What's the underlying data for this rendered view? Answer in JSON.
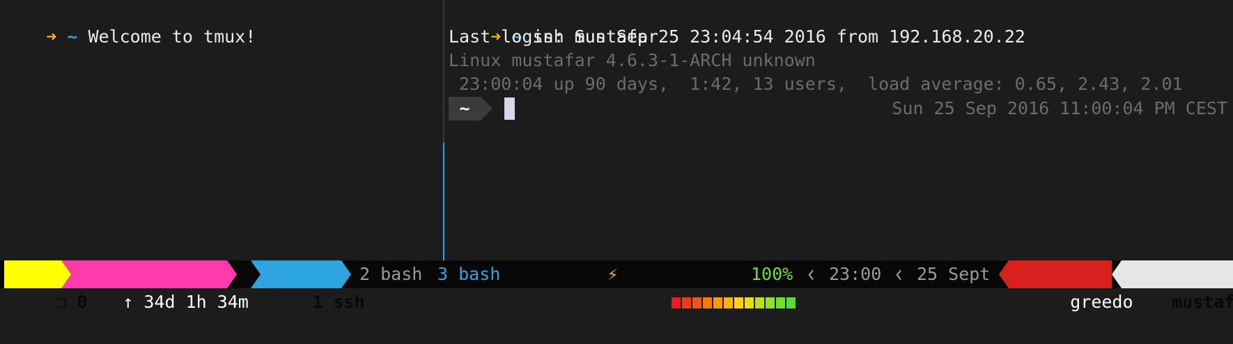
{
  "left_pane": {
    "prompt_arrow": "➜",
    "prompt_dir": "~",
    "text": "Welcome to tmux!"
  },
  "right_pane": {
    "prompt_arrow": "➜",
    "prompt_dir": "~",
    "command": "ssh mustafar",
    "last_login": "Last login: Sun Sep 25 23:04:54 2016 from 192.168.20.22",
    "motd_line1": "Linux mustafar 4.6.3-1-ARCH unknown",
    "motd_line2": " 23:00:04 up 90 days,  1:42, 13 users,  load average: 0.65, 2.43, 2.01",
    "zsh_prompt_dir": "~",
    "rprompt": "Sun 25 Sep 2016 11:00:04 PM CEST"
  },
  "status_bar": {
    "session": {
      "icon": "❐",
      "label": "0"
    },
    "uptime": {
      "icon": "↑",
      "label": "34d 1h 34m"
    },
    "windows": [
      {
        "label": "1 ssh",
        "active": true
      },
      {
        "label": "2 bash",
        "active": false
      },
      {
        "label": "3 bash",
        "active": false,
        "last": true
      }
    ],
    "battery": {
      "icon": "⚡",
      "percent_label": "100%",
      "level": 1.0,
      "cell_colors": [
        "#e8201c",
        "#ec3b16",
        "#f0560f",
        "#f47c0b",
        "#f89a08",
        "#fbb406",
        "#fdd40a",
        "#e6e00f",
        "#b8e21a",
        "#8ee323",
        "#6ee22b",
        "#57e032"
      ]
    },
    "time": "23:00",
    "date": "25 Sept",
    "username": "greedo",
    "hostname": "mustafar",
    "colors": {
      "session_bg": "#ffff00",
      "uptime_bg": "#ff3aaa",
      "active_window_bg": "#2fa5e0",
      "username_bg": "#d8211c",
      "hostname_bg": "#e6e6e6",
      "battery_text": "#6ee22b"
    }
  }
}
